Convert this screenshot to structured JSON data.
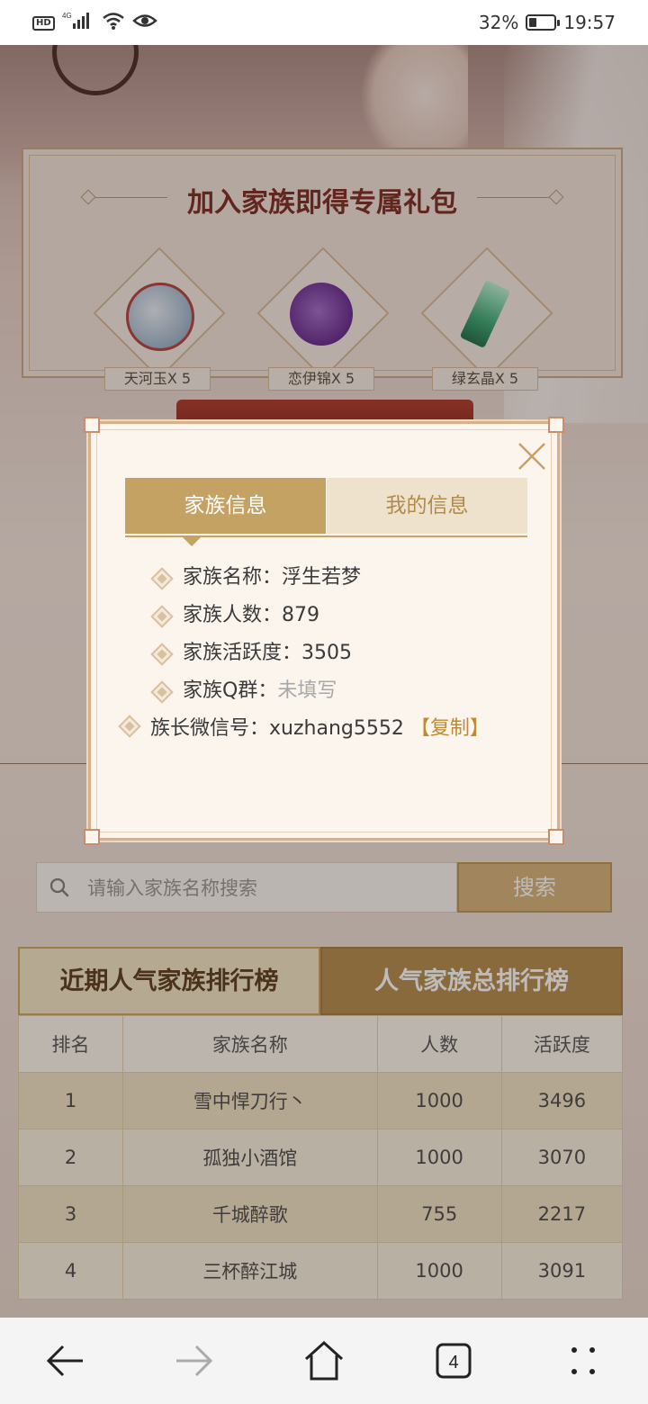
{
  "status_bar": {
    "hd": "HD",
    "network": "4G",
    "battery_percent": "32%",
    "battery_level": 0.32,
    "time": "19:57"
  },
  "gift_panel": {
    "title": "加入家族即得专属礼包",
    "items": [
      {
        "label": "天河玉X 5",
        "icon": "jade-pendant-icon"
      },
      {
        "label": "恋伊锦X 5",
        "icon": "purple-silk-icon"
      },
      {
        "label": "绿玄晶X 5",
        "icon": "green-crystal-icon"
      }
    ]
  },
  "modal": {
    "tabs": [
      {
        "label": "家族信息",
        "active": true
      },
      {
        "label": "我的信息",
        "active": false
      }
    ],
    "info": {
      "name_label": "家族名称：",
      "name_value": "浮生若梦",
      "count_label": "家族人数：",
      "count_value": "879",
      "activity_label": "家族活跃度：",
      "activity_value": "3505",
      "qq_label": "家族Q群：",
      "qq_value": "未填写",
      "wechat_label": "族长微信号：",
      "wechat_value": "xuzhang5552",
      "copy_label": "【复制】"
    }
  },
  "search": {
    "placeholder": "请输入家族名称搜索",
    "button_label": "搜索"
  },
  "ranking": {
    "tabs": [
      {
        "label": "近期人气家族排行榜",
        "active": true
      },
      {
        "label": "人气家族总排行榜",
        "active": false
      }
    ],
    "headers": [
      "排名",
      "家族名称",
      "人数",
      "活跃度"
    ],
    "rows": [
      [
        "1",
        "雪中悍刀行丶",
        "1000",
        "3496"
      ],
      [
        "2",
        "孤独小酒馆",
        "1000",
        "3070"
      ],
      [
        "3",
        "千城醉歌",
        "755",
        "2217"
      ],
      [
        "4",
        "三杯醉江城",
        "1000",
        "3091"
      ]
    ]
  },
  "colors": {
    "accent_gold": "#c4a264",
    "title_red": "#7a2a21",
    "copy_link": "#c08a2e"
  },
  "navbar": {
    "tab_count": "4"
  }
}
